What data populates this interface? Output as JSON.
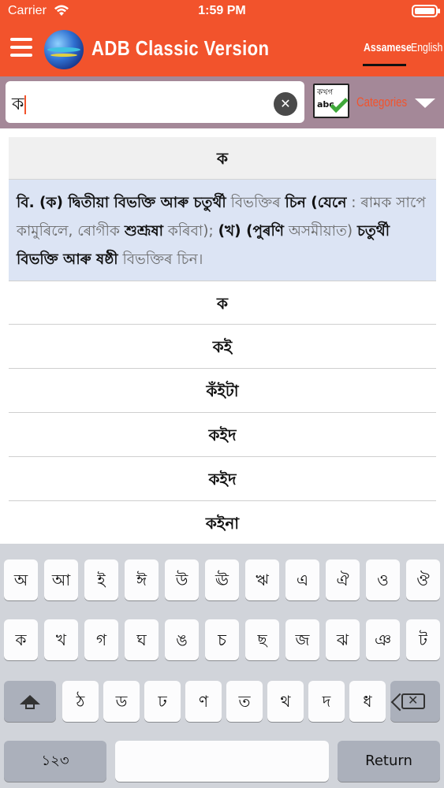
{
  "status_bar": {
    "carrier": "Carrier",
    "time": "1:59 PM"
  },
  "header": {
    "app_title": "ADB Classic Version",
    "lang_assamese": "Assamese",
    "lang_english": "English",
    "accent_color": "#f2532c"
  },
  "search": {
    "value": "ক",
    "categories_label": "Categories",
    "cat_icon_line1": "কখগ",
    "cat_icon_line2": "abc"
  },
  "result": {
    "headword": "ক",
    "definition": {
      "s1": "বি. (ক) দ্বিতীয়া বিভক্তি আৰু চতুৰ্থী",
      "s2": " বিভক্তিৰ ",
      "s3": "চিন (যেনে",
      "s4": " : ৰামক সাপে কামুৰিলে, ৰোগীক ",
      "s5": "শুশ্ৰূষা",
      "s6": " কৰিবা); ",
      "s7": "(খ) (পুৰণি",
      "s8": " অসমীয়াত) ",
      "s9": "চতুৰ্থী বিভক্তি আৰু ষষ্ঠী",
      "s10": " বিভক্তিৰ চিন।"
    }
  },
  "list_items": [
    "ক",
    "কই",
    "কঁইটা",
    "কইদ",
    "কইদ",
    "কইনা"
  ],
  "keyboard": {
    "row1": [
      "অ",
      "আ",
      "ই",
      "ঈ",
      "উ",
      "ঊ",
      "ঋ",
      "এ",
      "ঐ",
      "ও",
      "ঔ"
    ],
    "row2": [
      "ক",
      "খ",
      "গ",
      "ঘ",
      "ঙ",
      "চ",
      "ছ",
      "জ",
      "ঝ",
      "ঞ",
      "ট"
    ],
    "row3": [
      "ঠ",
      "ড",
      "ঢ",
      "ণ",
      "ত",
      "থ",
      "দ",
      "ধ"
    ],
    "numbers_label": "১২৩",
    "return_label": "Return"
  }
}
